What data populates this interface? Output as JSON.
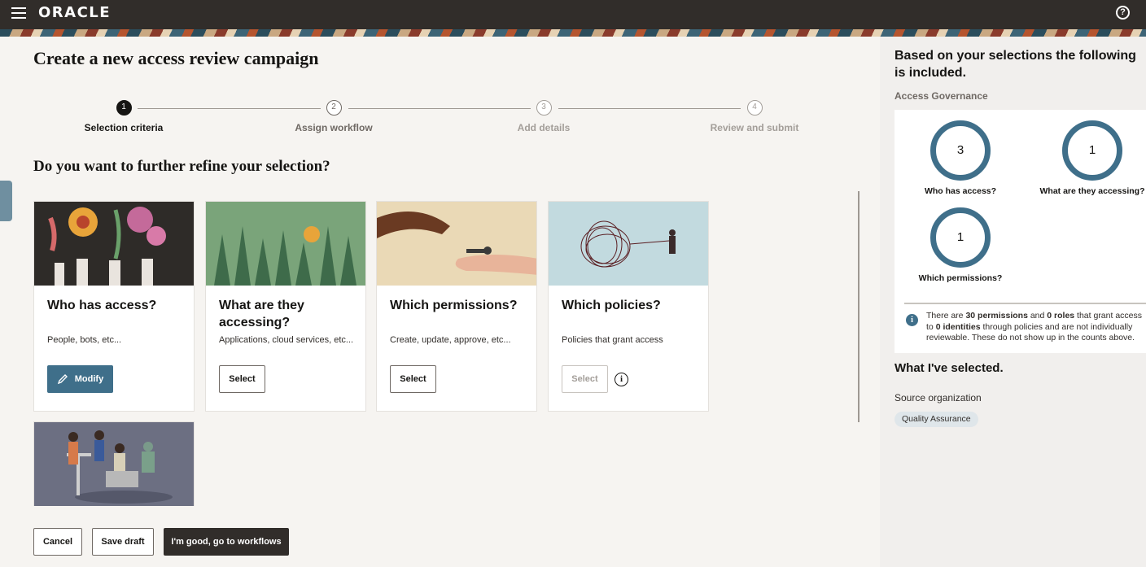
{
  "header": {
    "brand": "ORACLE",
    "menu_icon": "hamburger-icon",
    "help_icon": "help-circle-icon"
  },
  "page": {
    "title": "Create a new access review campaign",
    "subheading": "Do you want to further refine your selection?"
  },
  "stepper": [
    {
      "num": "1",
      "label": "Selection criteria",
      "state": "active"
    },
    {
      "num": "2",
      "label": "Assign workflow",
      "state": "pending"
    },
    {
      "num": "3",
      "label": "Add details",
      "state": "disabled"
    },
    {
      "num": "4",
      "label": "Review and submit",
      "state": "disabled"
    }
  ],
  "cards": [
    {
      "title": "Who has access?",
      "desc": "People, bots, etc...",
      "button": "Modify",
      "button_icon": "pencil-icon"
    },
    {
      "title": "What are they accessing?",
      "desc": "Applications, cloud services, etc...",
      "button": "Select"
    },
    {
      "title": "Which permissions?",
      "desc": "Create, update, approve, etc...",
      "button": "Select"
    },
    {
      "title": "Which policies?",
      "desc": "Policies that grant access",
      "button": "Select",
      "button_disabled": true,
      "info_icon": "info-icon"
    }
  ],
  "footer": {
    "cancel": "Cancel",
    "save": "Save draft",
    "continue": "I'm good, go to workflows"
  },
  "side": {
    "title": "Based on your selections the following is included.",
    "subtitle": "Access Governance",
    "metrics": [
      {
        "value": "3",
        "label": "Who has access?"
      },
      {
        "value": "1",
        "label": "What are they accessing?"
      },
      {
        "value": "1",
        "label": "Which permissions?"
      }
    ],
    "note": {
      "p1": "There are ",
      "permissions": "30 permissions",
      "p2": " and ",
      "roles": "0 roles",
      "p3": " that grant access to ",
      "identities": "0 identities",
      "p4": " through policies and are not individually reviewable. These do not show up in the counts above."
    },
    "selected_title": "What I've selected.",
    "source_label": "Source organization",
    "source_value": "Quality Assurance"
  },
  "colors": {
    "accent": "#3f6f8a",
    "topbar": "#312d2a",
    "primary_dark": "#312d2a"
  }
}
